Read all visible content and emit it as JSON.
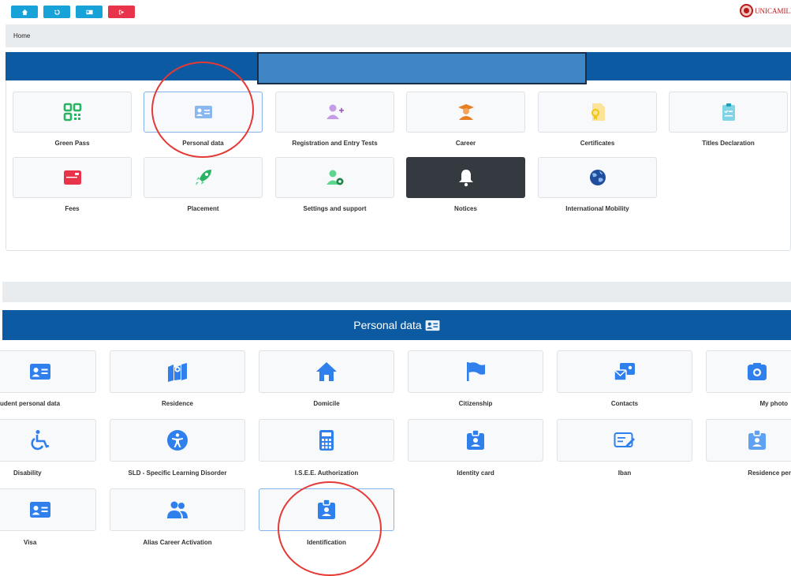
{
  "toolbar": {
    "buttons": [
      {
        "name": "home-button",
        "icon": "home-icon",
        "color": "#17a2d8"
      },
      {
        "name": "history-button",
        "icon": "history-icon",
        "color": "#17a2d8"
      },
      {
        "name": "card-button",
        "icon": "id-card-icon",
        "color": "#17a2d8"
      },
      {
        "name": "logout-button",
        "icon": "logout-icon",
        "color": "#e8344a"
      }
    ],
    "logo_text": "UNICAMILLUS"
  },
  "breadcrumb": {
    "home": "Home"
  },
  "main_tiles": [
    {
      "label": "Green Pass",
      "icon": "qr-code-icon"
    },
    {
      "label": "Personal data",
      "icon": "id-card-icon"
    },
    {
      "label": "Registration and Entry Tests",
      "icon": "user-plus-icon"
    },
    {
      "label": "Career",
      "icon": "graduate-icon"
    },
    {
      "label": "Certificates",
      "icon": "certificate-icon"
    },
    {
      "label": "Titles Declaration",
      "icon": "clipboard-icon"
    },
    {
      "label": "Fees",
      "icon": "credit-card-icon"
    },
    {
      "label": "Placement",
      "icon": "rocket-icon"
    },
    {
      "label": "Settings and support",
      "icon": "user-gear-icon"
    },
    {
      "label": "Notices",
      "icon": "bell-icon"
    },
    {
      "label": "International Mobility",
      "icon": "globe-icon"
    }
  ],
  "personal_data": {
    "title": "Personal data",
    "tiles": [
      {
        "label": "udent personal data",
        "icon": "id-card-icon"
      },
      {
        "label": "Residence",
        "icon": "map-icon"
      },
      {
        "label": "Domicile",
        "icon": "house-icon"
      },
      {
        "label": "Citizenship",
        "icon": "flag-icon"
      },
      {
        "label": "Contacts",
        "icon": "contacts-icon"
      },
      {
        "label": "My photo",
        "icon": "camera-icon"
      },
      {
        "label": "Disability",
        "icon": "wheelchair-icon"
      },
      {
        "label": "SLD - Specific Learning Disorder",
        "icon": "accessibility-icon"
      },
      {
        "label": "I.S.E.E. Authorization",
        "icon": "calculator-icon"
      },
      {
        "label": "Identity card",
        "icon": "badge-icon"
      },
      {
        "label": "Iban",
        "icon": "edit-card-icon"
      },
      {
        "label": "Residence per",
        "icon": "badge-icon"
      },
      {
        "label": "Visa",
        "icon": "id-card-icon"
      },
      {
        "label": "Alias Career Activation",
        "icon": "users-icon"
      },
      {
        "label": "Identification",
        "icon": "badge-icon"
      }
    ]
  }
}
